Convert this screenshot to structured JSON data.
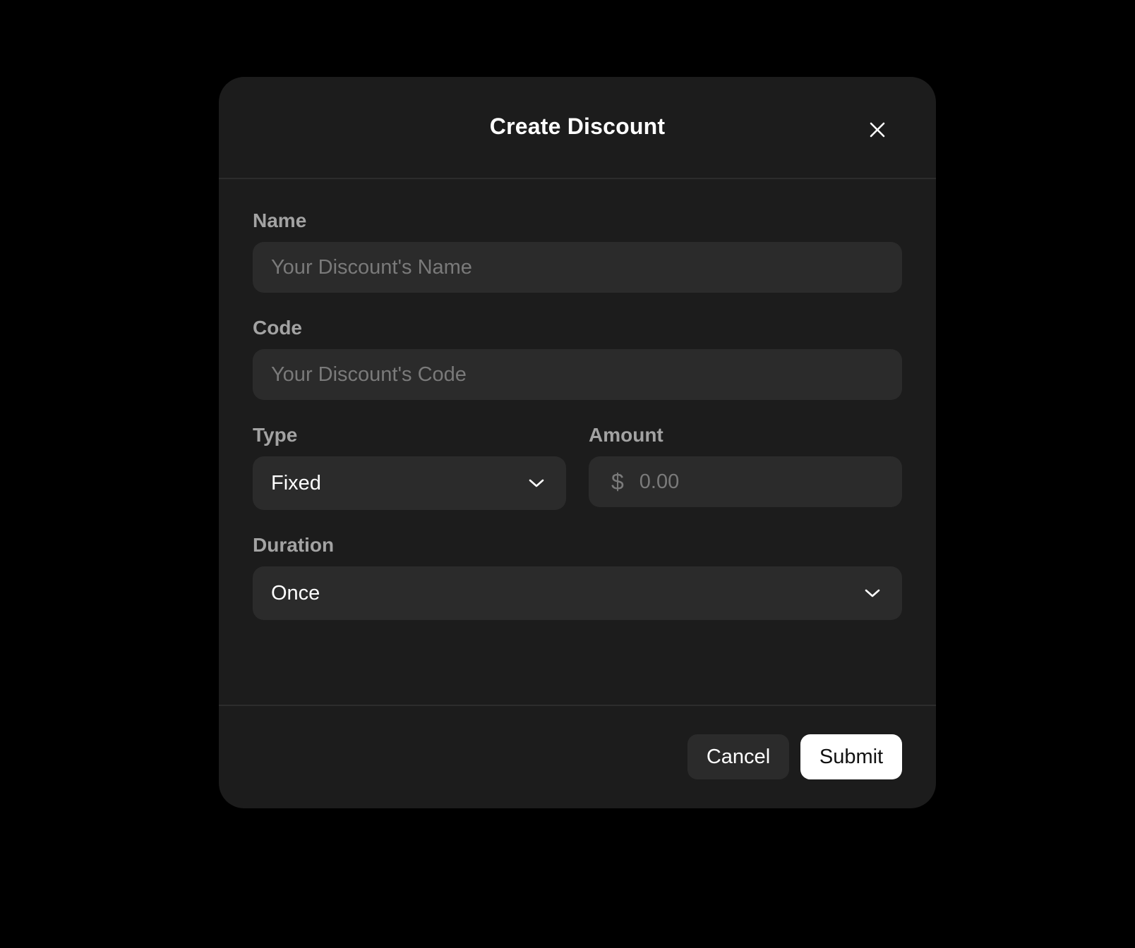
{
  "modal": {
    "title": "Create Discount"
  },
  "form": {
    "name": {
      "label": "Name",
      "value": "",
      "placeholder": "Your Discount's Name"
    },
    "code": {
      "label": "Code",
      "value": "",
      "placeholder": "Your Discount's Code"
    },
    "type": {
      "label": "Type",
      "selected": "Fixed"
    },
    "amount": {
      "label": "Amount",
      "currency_symbol": "$",
      "value": "",
      "placeholder": "0.00"
    },
    "duration": {
      "label": "Duration",
      "selected": "Once"
    }
  },
  "footer": {
    "cancel_label": "Cancel",
    "submit_label": "Submit"
  },
  "icons": {
    "close": "close-icon",
    "chevron": "chevron-down-icon"
  },
  "colors": {
    "background": "#000000",
    "modal_bg": "#1c1c1c",
    "input_bg": "#2b2b2b",
    "label": "#a3a3a3",
    "placeholder": "#7a7a7a",
    "primary_button_bg": "#ffffff",
    "primary_button_text": "#111111"
  }
}
